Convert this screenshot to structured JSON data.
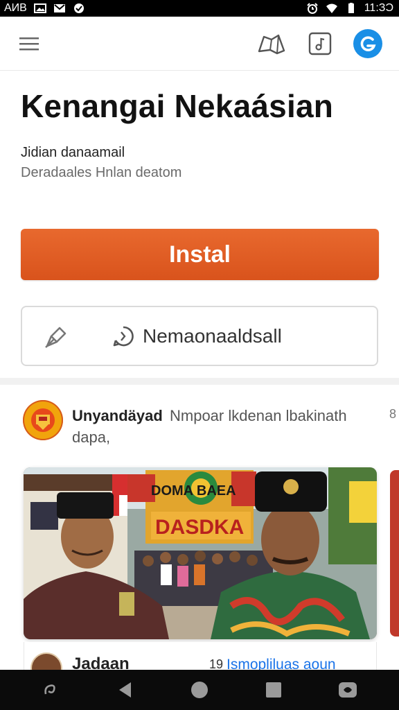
{
  "status_bar": {
    "carrier": "AИB",
    "time": "11:ЗƆ"
  },
  "app": {
    "title": "Kenangai Nekaásian",
    "subtitle_primary": "Jidian danaamail",
    "subtitle_secondary": "Deradaales Hnlan  deatom",
    "install_label": "Instal",
    "secondary_label": "Nemaonaaldsall"
  },
  "post": {
    "author": "Unyandäyad",
    "text_line1": "Nmpoar lkdenan lbakinath",
    "text_line2": "dapa,",
    "more": "8",
    "banner_text_top": "DOMA  BAEA",
    "banner_text_bottom": "DASDKA"
  },
  "card_footer": {
    "name": "Jadaan",
    "count": "19",
    "link": "Ismopliluas aoun"
  },
  "colors": {
    "accent_orange": "#e0602a",
    "accent_blue": "#1a8fe6",
    "link_blue": "#1a73e8"
  },
  "icons": {
    "menu": "hamburger-icon",
    "map": "map-icon",
    "music": "music-note-icon",
    "account": "account-g-icon",
    "pin": "pin-icon",
    "share": "share-icon",
    "nav_back": "back-icon",
    "nav_home": "home-icon",
    "nav_recent": "recent-apps-icon"
  }
}
